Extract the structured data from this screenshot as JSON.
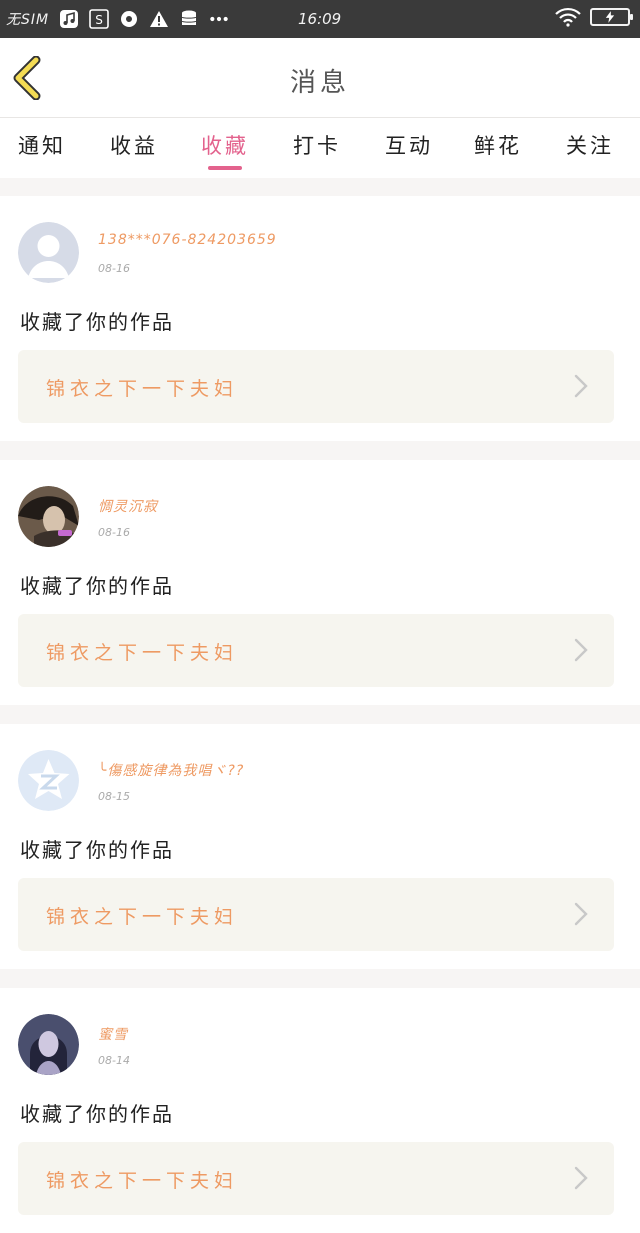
{
  "statusbar": {
    "carrier": "无SIM",
    "time": "16:09",
    "icons": [
      "music-icon",
      "s-app-icon",
      "at-icon",
      "warning-icon",
      "database-icon",
      "more-dots-icon",
      "wifi-icon",
      "battery-charging-icon"
    ]
  },
  "header": {
    "title": "消息",
    "back_icon": "chevron-left-icon"
  },
  "tabs": [
    {
      "label": "通知"
    },
    {
      "label": "收益"
    },
    {
      "label": "收藏",
      "active": true
    },
    {
      "label": "打卡"
    },
    {
      "label": "互动"
    },
    {
      "label": "鲜花"
    },
    {
      "label": "关注"
    }
  ],
  "colors": {
    "accent": "#e3628d",
    "username": "#ee9a63",
    "work_bg": "#f6f5ef",
    "page_bg": "#f7f5f4"
  },
  "messages": [
    {
      "username": "138***076-824203659",
      "date": "08-16",
      "action": "收藏了你的作品",
      "work_title": "锦衣之下一下夫妇",
      "avatar": "default-avatar"
    },
    {
      "username": "惆灵沉寂",
      "date": "08-16",
      "action": "收藏了你的作品",
      "work_title": "锦衣之下一下夫妇",
      "avatar": "photo-avatar"
    },
    {
      "username": "╰傷感旋律為我唱ヾ??",
      "date": "08-15",
      "action": "收藏了你的作品",
      "work_title": "锦衣之下一下夫妇",
      "avatar": "qzone-star-avatar"
    },
    {
      "username": "蜜雪",
      "date": "08-14",
      "action": "收藏了你的作品",
      "work_title": "锦衣之下一下夫妇",
      "avatar": "photo-avatar"
    }
  ]
}
